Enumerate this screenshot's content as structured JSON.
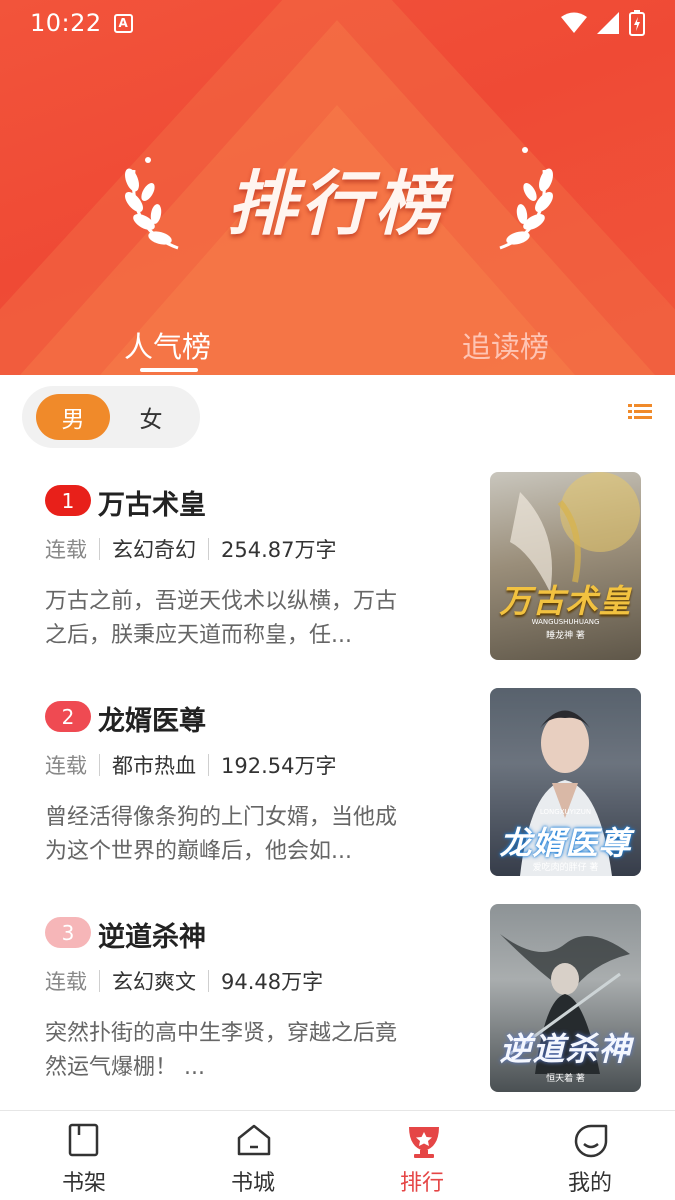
{
  "status_bar": {
    "time": "10:22",
    "notification_badge": "A"
  },
  "header": {
    "title": "排行榜",
    "tabs": [
      {
        "label": "人气榜",
        "active": true
      },
      {
        "label": "追读榜",
        "active": false
      }
    ]
  },
  "filter": {
    "genders": [
      {
        "label": "男",
        "selected": true
      },
      {
        "label": "女",
        "selected": false
      }
    ],
    "list_icon": "list-icon"
  },
  "books": [
    {
      "rank": "1",
      "rank_color": "#e8201a",
      "title": "万古术皇",
      "status": "连载",
      "genre": "玄幻奇幻",
      "word_count": "254.87万字",
      "description": "万古之前，吾逆天伐术以纵横，万古之后，朕秉应天道而称皇，任...",
      "cover_title": "万古术皇",
      "cover_subtitle": "WANGUSHUHUANG",
      "cover_author": "睡龙神 著"
    },
    {
      "rank": "2",
      "rank_color": "#ef4a52",
      "title": "龙婿医尊",
      "status": "连载",
      "genre": "都市热血",
      "word_count": "192.54万字",
      "description": "曾经活得像条狗的上门女婿，当他成为这个世界的巅峰后，他会如...",
      "cover_title": "龙婿医尊",
      "cover_subtitle": "LONGXUYIZUN",
      "cover_author": "爱吃肉的胖仔 著"
    },
    {
      "rank": "3",
      "rank_color": "#f6b6b8",
      "title": "逆道杀神",
      "status": "连载",
      "genre": "玄幻爽文",
      "word_count": "94.48万字",
      "description": "突然扑街的高中生李贤，穿越之后竟然运气爆棚！ ...",
      "cover_title": "逆道杀神",
      "cover_subtitle": "",
      "cover_author": "恒天着 著"
    }
  ],
  "bottom_nav": [
    {
      "label": "书架",
      "icon": "bookshelf-icon",
      "active": false
    },
    {
      "label": "书城",
      "icon": "bookstore-icon",
      "active": false
    },
    {
      "label": "排行",
      "icon": "trophy-icon",
      "active": true
    },
    {
      "label": "我的",
      "icon": "profile-icon",
      "active": false
    }
  ]
}
